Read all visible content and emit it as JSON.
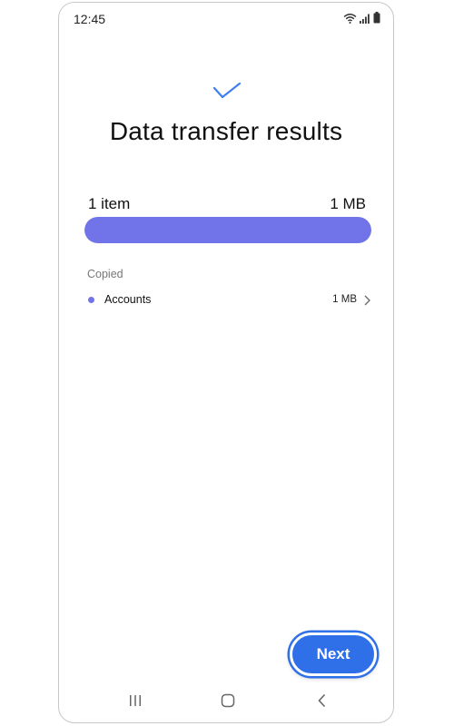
{
  "status_bar": {
    "time": "12:45",
    "icons": [
      "wifi-icon",
      "signal-icon",
      "battery-icon"
    ]
  },
  "header": {
    "icon": "check-icon",
    "title": "Data transfer results"
  },
  "summary": {
    "count": "1 item",
    "size": "1 MB",
    "progress_fraction": 1.0
  },
  "section": {
    "label": "Copied",
    "items": [
      {
        "label": "Accounts",
        "size": "1 MB",
        "icon": "chevron-right-icon"
      }
    ]
  },
  "actions": {
    "next_label": "Next"
  },
  "nav": {
    "icons": [
      "recent-apps-icon",
      "home-icon",
      "back-icon"
    ]
  },
  "colors": {
    "accent": "#7074e8",
    "button": "#2f6fe8",
    "check": "#3f7ef0"
  }
}
